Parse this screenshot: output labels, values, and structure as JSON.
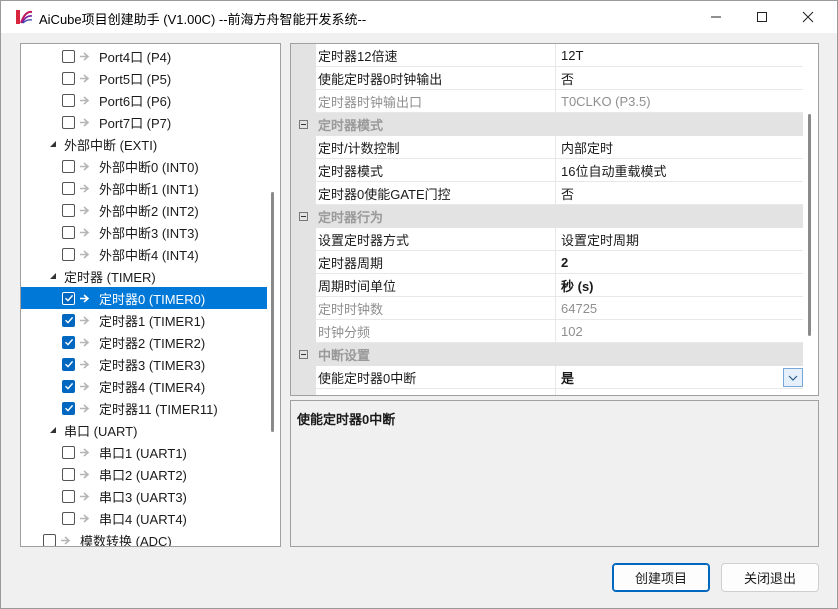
{
  "window": {
    "title": "AiCube项目创建助手 (V1.00C) --前海方舟智能开发系统--"
  },
  "tree": {
    "items": [
      {
        "label": "Port4口 (P4)",
        "level": 2,
        "checked": false,
        "kind": "leaf"
      },
      {
        "label": "Port5口 (P5)",
        "level": 2,
        "checked": false,
        "kind": "leaf"
      },
      {
        "label": "Port6口 (P6)",
        "level": 2,
        "checked": false,
        "kind": "leaf"
      },
      {
        "label": "Port7口 (P7)",
        "level": 2,
        "checked": false,
        "kind": "leaf"
      },
      {
        "label": "外部中断 (EXTI)",
        "level": 1,
        "kind": "group"
      },
      {
        "label": "外部中断0 (INT0)",
        "level": 2,
        "checked": false,
        "kind": "leaf"
      },
      {
        "label": "外部中断1 (INT1)",
        "level": 2,
        "checked": false,
        "kind": "leaf"
      },
      {
        "label": "外部中断2 (INT2)",
        "level": 2,
        "checked": false,
        "kind": "leaf"
      },
      {
        "label": "外部中断3 (INT3)",
        "level": 2,
        "checked": false,
        "kind": "leaf"
      },
      {
        "label": "外部中断4 (INT4)",
        "level": 2,
        "checked": false,
        "kind": "leaf"
      },
      {
        "label": "定时器 (TIMER)",
        "level": 1,
        "kind": "group"
      },
      {
        "label": "定时器0 (TIMER0)",
        "level": 2,
        "checked": true,
        "kind": "leaf",
        "selected": true
      },
      {
        "label": "定时器1 (TIMER1)",
        "level": 2,
        "checked": true,
        "kind": "leaf"
      },
      {
        "label": "定时器2 (TIMER2)",
        "level": 2,
        "checked": true,
        "kind": "leaf"
      },
      {
        "label": "定时器3 (TIMER3)",
        "level": 2,
        "checked": true,
        "kind": "leaf"
      },
      {
        "label": "定时器4 (TIMER4)",
        "level": 2,
        "checked": true,
        "kind": "leaf"
      },
      {
        "label": "定时器11 (TIMER11)",
        "level": 2,
        "checked": true,
        "kind": "leaf"
      },
      {
        "label": "串口 (UART)",
        "level": 1,
        "kind": "group"
      },
      {
        "label": "串口1 (UART1)",
        "level": 2,
        "checked": false,
        "kind": "leaf"
      },
      {
        "label": "串口2 (UART2)",
        "level": 2,
        "checked": false,
        "kind": "leaf"
      },
      {
        "label": "串口3 (UART3)",
        "level": 2,
        "checked": false,
        "kind": "leaf"
      },
      {
        "label": "串口4 (UART4)",
        "level": 2,
        "checked": false,
        "kind": "leaf"
      },
      {
        "label": "模数转换 (ADC)",
        "level": 0,
        "checked": false,
        "kind": "leaf"
      }
    ]
  },
  "properties": {
    "rows": [
      {
        "type": "prop",
        "name": "定时器12倍速",
        "value": "12T"
      },
      {
        "type": "prop",
        "name": "使能定时器0时钟输出",
        "value": "否"
      },
      {
        "type": "prop",
        "name": "定时器时钟输出口",
        "value": "T0CLKO (P3.5)",
        "disabled": true
      },
      {
        "type": "cat",
        "name": "定时器模式"
      },
      {
        "type": "prop",
        "name": "定时/计数控制",
        "value": "内部定时"
      },
      {
        "type": "prop",
        "name": "定时器模式",
        "value": "16位自动重载模式"
      },
      {
        "type": "prop",
        "name": "定时器0使能GATE门控",
        "value": "否"
      },
      {
        "type": "cat",
        "name": "定时器行为"
      },
      {
        "type": "prop",
        "name": "设置定时器方式",
        "value": "设置定时周期"
      },
      {
        "type": "prop",
        "name": "定时器周期",
        "value": "2",
        "bold": true
      },
      {
        "type": "prop",
        "name": "周期时间单位",
        "value": "秒 (s)",
        "bold": true
      },
      {
        "type": "prop",
        "name": "定时时钟数",
        "value": "64725",
        "disabled": true
      },
      {
        "type": "prop",
        "name": "时钟分频",
        "value": "102",
        "disabled": true
      },
      {
        "type": "cat",
        "name": "中断设置"
      },
      {
        "type": "prop",
        "name": "使能定时器0中断",
        "value": "是",
        "bold": true,
        "active": true
      }
    ]
  },
  "description": {
    "title": "使能定时器0中断"
  },
  "buttons": {
    "create": "创建项目",
    "exit": "关闭退出"
  },
  "colors": {
    "selection": "#0078d7",
    "checkbox_checked": "#0067c0",
    "category_bg": "#e3e3e3"
  }
}
